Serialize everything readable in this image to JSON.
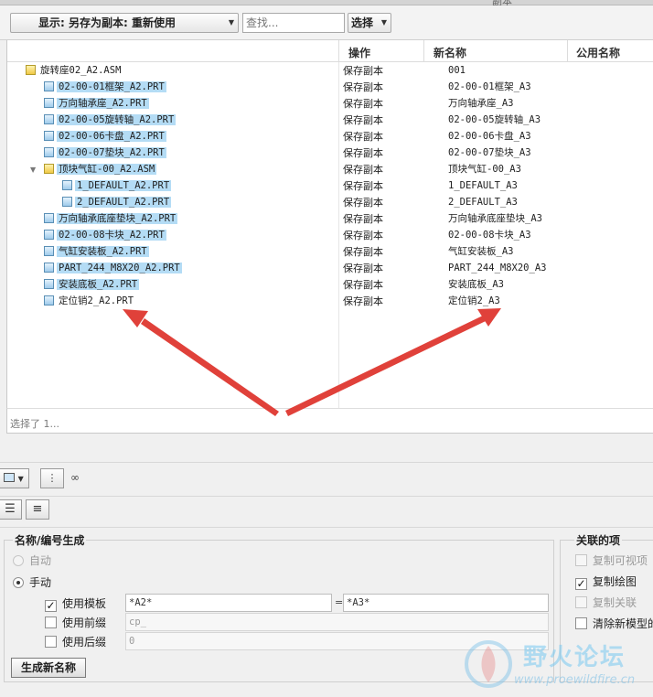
{
  "title_partial": "副本",
  "toolbar": {
    "display_label": "显示: 另存为副本: 重新使用",
    "search_placeholder": "查找...",
    "select_label": "选择"
  },
  "columns": {
    "operation": "操作",
    "new_name": "新名称",
    "common_name": "公用名称"
  },
  "rows": [
    {
      "name": "旋转座02_A2.ASM",
      "operation": "保存副本",
      "new_name": "001"
    },
    {
      "name": "02-00-01框架_A2.PRT",
      "operation": "保存副本",
      "new_name": "02-00-01框架_A3"
    },
    {
      "name": "万向轴承座_A2.PRT",
      "operation": "保存副本",
      "new_name": "万向轴承座_A3"
    },
    {
      "name": "02-00-05旋转轴_A2.PRT",
      "operation": "保存副本",
      "new_name": "02-00-05旋转轴_A3"
    },
    {
      "name": "02-00-06卡盘_A2.PRT",
      "operation": "保存副本",
      "new_name": "02-00-06卡盘_A3"
    },
    {
      "name": "02-00-07垫块_A2.PRT",
      "operation": "保存副本",
      "new_name": "02-00-07垫块_A3"
    },
    {
      "name": "顶块气缸-00_A2.ASM",
      "operation": "保存副本",
      "new_name": "顶块气缸-00_A3"
    },
    {
      "name": "1_DEFAULT_A2.PRT",
      "operation": "保存副本",
      "new_name": "1_DEFAULT_A3"
    },
    {
      "name": "2_DEFAULT_A2.PRT",
      "operation": "保存副本",
      "new_name": "2_DEFAULT_A3"
    },
    {
      "name": "万向轴承底座垫块_A2.PRT",
      "operation": "保存副本",
      "new_name": "万向轴承底座垫块_A3"
    },
    {
      "name": "02-00-08卡块_A2.PRT",
      "operation": "保存副本",
      "new_name": "02-00-08卡块_A3"
    },
    {
      "name": "气缸安装板_A2.PRT",
      "operation": "保存副本",
      "new_name": "气缸安装板_A3"
    },
    {
      "name": "PART_244_M8X20_A2.PRT",
      "operation": "保存副本",
      "new_name": "PART_244_M8X20_A3"
    },
    {
      "name": "安装底板_A2.PRT",
      "operation": "保存副本",
      "new_name": "安装底板_A3"
    },
    {
      "name": "定位销2_A2.PRT",
      "operation": "保存副本",
      "new_name": "定位销2_A3"
    }
  ],
  "status": "选择了 1...",
  "name_gen": {
    "group_title": "名称/编号生成",
    "auto_label": "自动",
    "manual_label": "手动",
    "use_template_label": "使用模板",
    "template_from": "*A2*",
    "eq": "=",
    "template_to": "*A3*",
    "use_prefix_label": "使用前缀",
    "prefix_value": "cp_",
    "use_suffix_label": "使用后缀",
    "suffix_value": "0",
    "generate_button": "生成新名称"
  },
  "related": {
    "group_title": "关联的项",
    "copy_views": "复制可视项",
    "copy_drawings": "复制绘图",
    "copy_relations": "复制关联",
    "clear_model": "清除新模型的"
  },
  "watermark": {
    "title": "野火论坛",
    "url": "www.proewildfire.cn"
  },
  "colors": {
    "selection": "#b4dcf5",
    "arrow": "#e0413a"
  }
}
